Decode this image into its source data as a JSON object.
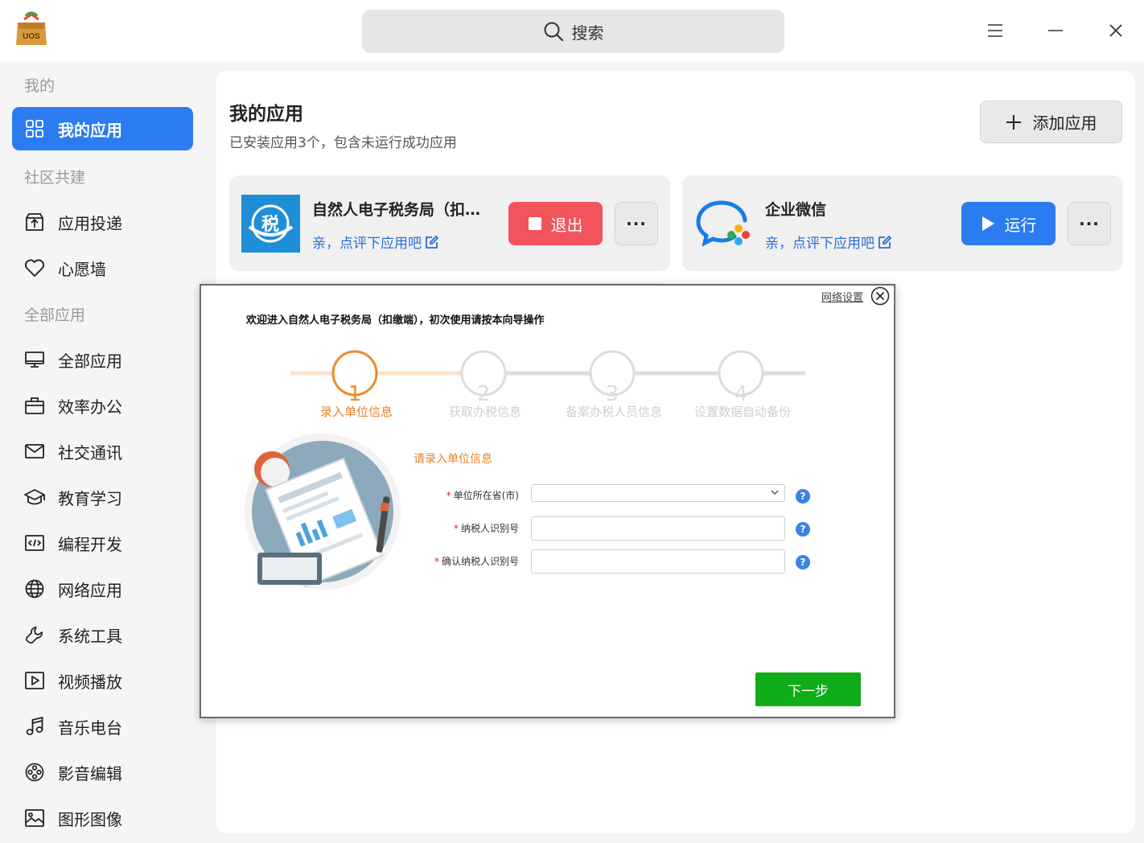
{
  "titlebar": {
    "logo_text": "UOS",
    "search_label": "搜索",
    "menu_icon": "hamburger-icon",
    "minimize_icon": "minimize-icon",
    "close_icon": "close-icon"
  },
  "sidebar": {
    "sections": [
      {
        "title": "我的",
        "items": [
          {
            "label": "我的应用",
            "icon": "grid-icon",
            "active": true
          }
        ]
      },
      {
        "title": "社区共建",
        "items": [
          {
            "label": "应用投递",
            "icon": "upload-box-icon"
          },
          {
            "label": "心愿墙",
            "icon": "heart-icon"
          }
        ]
      },
      {
        "title": "全部应用",
        "items": [
          {
            "label": "全部应用",
            "icon": "monitor-icon"
          },
          {
            "label": "效率办公",
            "icon": "briefcase-icon"
          },
          {
            "label": "社交通讯",
            "icon": "mail-icon"
          },
          {
            "label": "教育学习",
            "icon": "graduation-cap-icon"
          },
          {
            "label": "编程开发",
            "icon": "code-icon"
          },
          {
            "label": "网络应用",
            "icon": "globe-icon"
          },
          {
            "label": "系统工具",
            "icon": "wrench-icon"
          },
          {
            "label": "视频播放",
            "icon": "video-play-icon"
          },
          {
            "label": "音乐电台",
            "icon": "music-note-icon"
          },
          {
            "label": "影音编辑",
            "icon": "film-reel-icon"
          },
          {
            "label": "图形图像",
            "icon": "image-icon"
          }
        ]
      }
    ]
  },
  "main": {
    "title": "我的应用",
    "subtitle": "已安装应用3个，包含未运行成功应用",
    "add_button": "添加应用",
    "apps": [
      {
        "name": "自然人电子税务局（扣缴端）",
        "review": "亲，点评下应用吧",
        "action": "退出",
        "icon_text": "税"
      },
      {
        "name": "企业微信",
        "review": "亲，点评下应用吧",
        "action": "运行"
      }
    ],
    "more_label": "···"
  },
  "dialog": {
    "network_link": "网络设置",
    "welcome": "欢迎进入自然人电子税务局（扣缴端），初次使用请按本向导操作",
    "steps": [
      {
        "num": "1",
        "label": "录入单位信息",
        "active": true
      },
      {
        "num": "2",
        "label": "获取办税信息",
        "active": false
      },
      {
        "num": "3",
        "label": "备案办税人员信息",
        "active": false
      },
      {
        "num": "4",
        "label": "设置数据自动备份",
        "active": false
      }
    ],
    "form_title": "请录入单位信息",
    "fields": {
      "province": {
        "label": "单位所在省(市)",
        "value": ""
      },
      "taxpayer_id": {
        "label": "纳税人识别号",
        "value": ""
      },
      "confirm_taxpayer_id": {
        "label": "确认纳税人识别号",
        "value": ""
      }
    },
    "required_mark": "*",
    "help_mark": "?",
    "next_button": "下一步"
  },
  "colors": {
    "accent_blue": "#2a7cf0",
    "exit_red": "#f2545b",
    "step_orange": "#e8822a",
    "next_green": "#0eac17",
    "link_blue": "#2a6fd6"
  }
}
